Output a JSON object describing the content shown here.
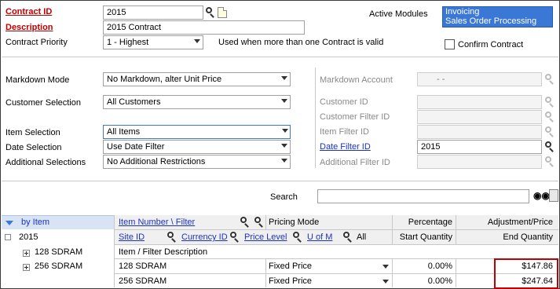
{
  "form": {
    "contract_id_label": "Contract ID",
    "contract_id": "2015",
    "description_label": "Description",
    "description": "2015 Contract",
    "priority_label": "Contract Priority",
    "priority": "1 - Highest",
    "priority_note": "Used when more than one Contract is valid",
    "active_modules_label": "Active Modules",
    "active_modules": [
      "Invoicing",
      "Sales Order Processing"
    ],
    "confirm_contract_label": "Confirm Contract",
    "confirm_contract_checked": false
  },
  "selections": {
    "markdown_mode_label": "Markdown Mode",
    "markdown_mode": "No Markdown, alter Unit Price",
    "customer_selection_label": "Customer Selection",
    "customer_selection": "All Customers",
    "item_selection_label": "Item Selection",
    "item_selection": "All Items",
    "date_selection_label": "Date Selection",
    "date_selection": "Use Date Filter",
    "additional_selections_label": "Additional Selections",
    "additional_selections": "No Additional Restrictions",
    "markdown_account_label": "Markdown Account",
    "markdown_account": "-      -",
    "customer_id_label": "Customer ID",
    "customer_filter_id_label": "Customer Filter ID",
    "item_filter_id_label": "Item Filter ID",
    "date_filter_id_label": "Date Filter ID",
    "date_filter_id": "2015",
    "additional_filter_id_label": "Additional Filter ID"
  },
  "search": {
    "label": "Search",
    "value": ""
  },
  "tree": {
    "header": "by Item",
    "root": "2015",
    "children": [
      "128 SDRAM",
      "256 SDRAM"
    ]
  },
  "grid": {
    "headers": {
      "item_number": "Item Number \\ Filter",
      "pricing_mode": "Pricing Mode",
      "percentage": "Percentage",
      "adjustment": "Adjustment/Price",
      "site_id": "Site ID",
      "currency_id": "Currency ID",
      "price_level": "Price Level",
      "u_of_m": "U of M",
      "all": "All",
      "start_qty": "Start Quantity",
      "end_qty": "End Quantity",
      "item_desc": "Item / Filter Description"
    },
    "rows": [
      {
        "item": "128 SDRAM",
        "mode": "Fixed Price",
        "percentage": "0.00%",
        "price": "$147.86"
      },
      {
        "item": "256 SDRAM",
        "mode": "Fixed Price",
        "percentage": "0.00%",
        "price": "$247.64"
      }
    ]
  },
  "colors": {
    "label_red": "#c00000",
    "link_blue": "#1a32c8",
    "modules_bg": "#3b78d6"
  }
}
